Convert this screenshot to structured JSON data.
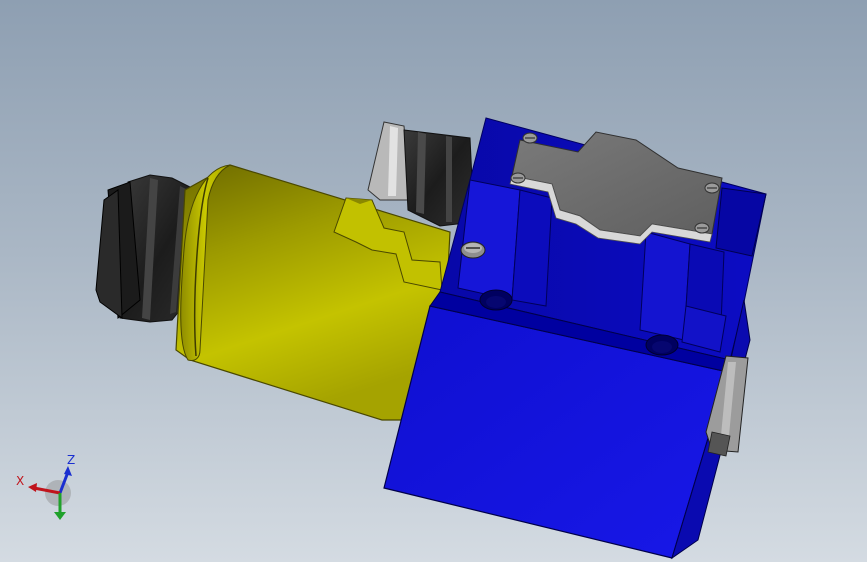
{
  "triad": {
    "x_label": "X",
    "z_label": "Z",
    "x_color": "#c0141c",
    "y_color": "#1fa12a",
    "z_color": "#1a2fd0"
  },
  "model": {
    "body_color": "#1010d8",
    "solenoid_color": "#b8b800",
    "connector_color": "#262626",
    "cover_plate_color": "#6e6e6e"
  }
}
